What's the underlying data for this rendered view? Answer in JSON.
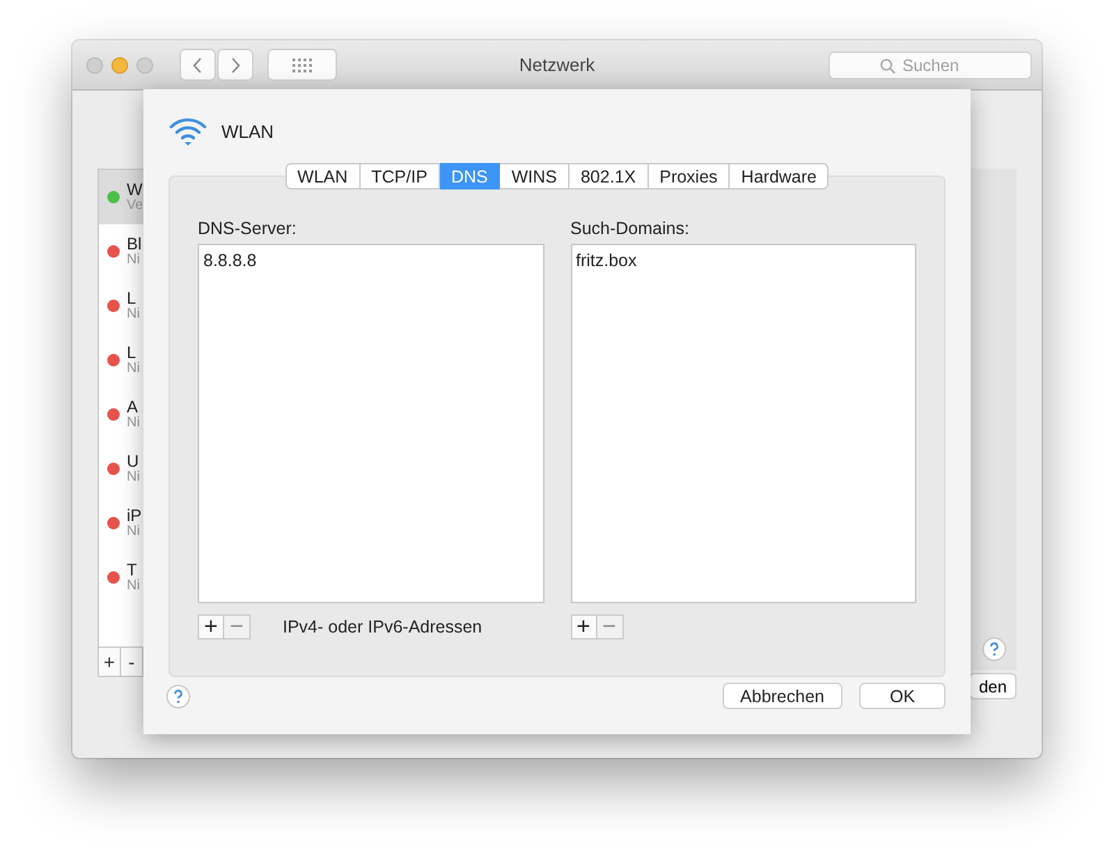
{
  "window": {
    "title": "Netzwerk",
    "search": {
      "placeholder": "Suchen"
    }
  },
  "sidebar": {
    "items": [
      {
        "name": "W",
        "status": "Ve",
        "color": "#4cc04a",
        "selected": true
      },
      {
        "name": "Bl",
        "status": "Ni",
        "color": "#e5534b",
        "selected": false
      },
      {
        "name": "L",
        "status": "Ni",
        "color": "#e5534b",
        "selected": false
      },
      {
        "name": "L",
        "status": "Ni",
        "color": "#e5534b",
        "selected": false
      },
      {
        "name": "A",
        "status": "Ni",
        "color": "#e5534b",
        "selected": false
      },
      {
        "name": "U",
        "status": "Ni",
        "color": "#e5534b",
        "selected": false
      },
      {
        "name": "iP",
        "status": "Ni",
        "color": "#e5534b",
        "selected": false
      },
      {
        "name": "T",
        "status": "Ni",
        "color": "#e5534b",
        "selected": false
      }
    ],
    "buttons": [
      {
        "label": "+",
        "disabled": false
      },
      {
        "label": "-",
        "disabled": false
      }
    ]
  },
  "background_button": {
    "label": "den"
  },
  "sheet": {
    "interface": "WLAN",
    "tabs": [
      {
        "label": "WLAN",
        "selected": false
      },
      {
        "label": "TCP/IP",
        "selected": false
      },
      {
        "label": "DNS",
        "selected": true
      },
      {
        "label": "WINS",
        "selected": false
      },
      {
        "label": "802.1X",
        "selected": false
      },
      {
        "label": "Proxies",
        "selected": false
      },
      {
        "label": "Hardware",
        "selected": false
      }
    ],
    "dns_servers": {
      "label": "DNS-Server:",
      "entries": [
        "8.8.8.8"
      ],
      "buttons": [
        {
          "label": "+",
          "disabled": false
        },
        {
          "label": "−",
          "disabled": true
        }
      ],
      "hint": "IPv4- oder IPv6-Adressen"
    },
    "search_domains": {
      "label": "Such-Domains:",
      "entries": [
        "fritz.box"
      ],
      "buttons": [
        {
          "label": "+",
          "disabled": false
        },
        {
          "label": "−",
          "disabled": true
        }
      ]
    },
    "buttons": [
      {
        "label": "Abbrechen"
      },
      {
        "label": "OK"
      }
    ]
  }
}
